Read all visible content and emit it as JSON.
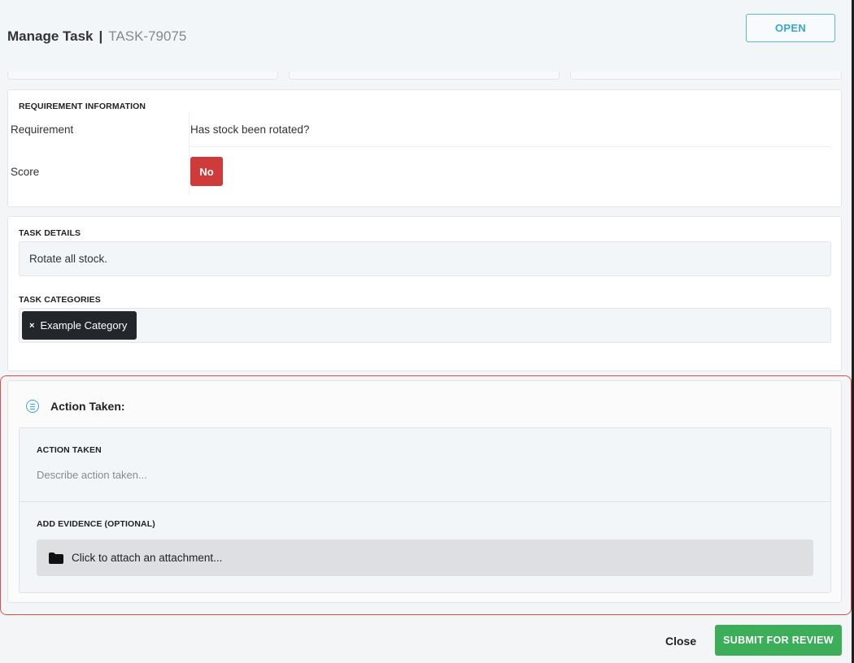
{
  "header": {
    "title": "Manage Task",
    "separator": "|",
    "task_id": "TASK-79075",
    "status_label": "OPEN"
  },
  "requirement": {
    "section_title": "REQUIREMENT INFORMATION",
    "requirement_label": "Requirement",
    "requirement_value": "Has stock been rotated?",
    "score_label": "Score",
    "score_value": "No",
    "score_color": "#cf3a3a"
  },
  "task": {
    "details_title": "TASK DETAILS",
    "details_value": "Rotate all stock.",
    "categories_title": "TASK CATEGORIES",
    "categories": [
      {
        "label": "Example Category",
        "remove_glyph": "×"
      }
    ]
  },
  "action": {
    "heading": "Action Taken:",
    "heading_icon": "list-circle-icon",
    "field_title": "ACTION TAKEN",
    "field_value": "",
    "field_placeholder": "Describe action taken...",
    "evidence_title": "ADD EVIDENCE (OPTIONAL)",
    "attach_label": "Click to attach an attachment...",
    "attach_icon": "folder-icon"
  },
  "footer": {
    "close_label": "Close",
    "submit_label": "SUBMIT FOR REVIEW",
    "submit_color": "#3cae5a"
  },
  "colors": {
    "accent": "#3aa6cf",
    "highlight_border": "#e24c4c"
  }
}
